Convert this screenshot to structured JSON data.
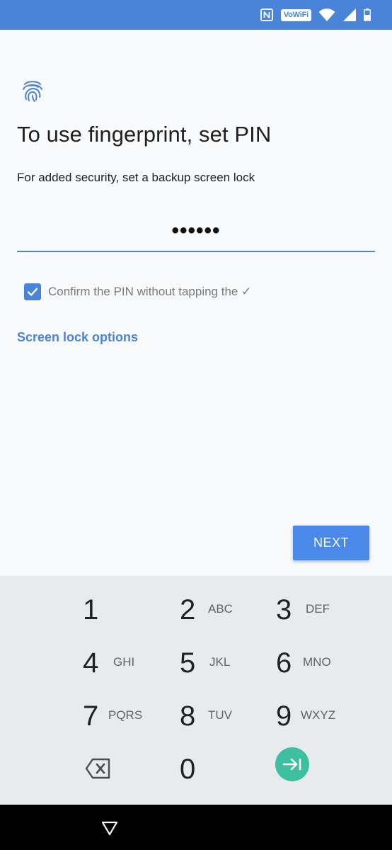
{
  "status_bar": {
    "vowifi_label": "VoWiFi",
    "color": "#4a84d8"
  },
  "content": {
    "icon": "fingerprint-icon",
    "title": "To use fingerprint, set PIN",
    "subtitle": "For added security, set a backup screen lock",
    "pin_value": "••••••",
    "confirm_checkbox": {
      "checked": true,
      "label": "Confirm the PIN without tapping the ✓"
    },
    "screen_lock_options_label": "Screen lock options",
    "next_label": "NEXT",
    "accent_color": "#4a84d8"
  },
  "keypad": {
    "keys": [
      {
        "digit": "1",
        "letters": ""
      },
      {
        "digit": "2",
        "letters": "ABC"
      },
      {
        "digit": "3",
        "letters": "DEF"
      },
      {
        "digit": "4",
        "letters": "GHI"
      },
      {
        "digit": "5",
        "letters": "JKL"
      },
      {
        "digit": "6",
        "letters": "MNO"
      },
      {
        "digit": "7",
        "letters": "PQRS"
      },
      {
        "digit": "8",
        "letters": "TUV"
      },
      {
        "digit": "9",
        "letters": "WXYZ"
      },
      {
        "digit": "0",
        "letters": ""
      }
    ],
    "backspace_icon": "backspace-icon",
    "enter_icon": "tab-arrow-icon",
    "enter_color": "#3dbfa0"
  },
  "nav_bar": {
    "back_icon": "back-triangle-icon"
  }
}
